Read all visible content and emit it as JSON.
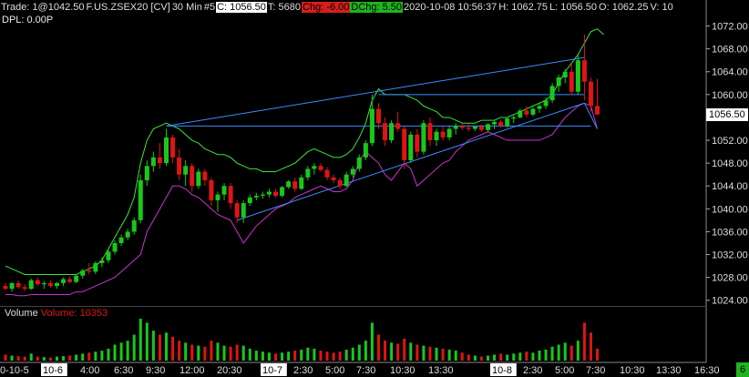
{
  "header": {
    "trade": "Trade: 1@1042.50",
    "symbol": "F.US.ZSEX20 [CV]",
    "interval": "30 Min",
    "num": "#5",
    "close": "C: 1056.50",
    "ticks": "T: 5680",
    "chg": "Chg: -6.00",
    "dchg": "DChg: 5.50",
    "datetime": "2020-10-08 10:56:37",
    "high": "H: 1062.75",
    "low": "L: 1056.50",
    "open": "O: 1062.25",
    "volume_tail": "V: 10"
  },
  "dpl": "DPL: 0.00P",
  "volume_label": "Volume",
  "volume_value": "Volume: 10353",
  "current_price": "1056.50",
  "badge": "6",
  "colors": {
    "bull": "#19c819",
    "bear": "#e01414",
    "upper_band": "#39e639",
    "lower_band": "#cc33cc",
    "trendline": "#3a8cff"
  },
  "chart_data": {
    "type": "candlestick",
    "price_axis": {
      "ticks": [
        "1072.00",
        "1068.00",
        "1064.00",
        "1060.00",
        "1056.00",
        "1052.00",
        "1048.00",
        "1044.00",
        "1040.00",
        "1036.00",
        "1032.00",
        "1028.00",
        "1024.00"
      ],
      "range": [
        1023,
        1074
      ]
    },
    "time_axis": {
      "labels": [
        "0-10-5",
        "10-6",
        "4:00",
        "6:30",
        "9:30",
        "12:00",
        "20:30",
        "10-7",
        "2:30",
        "5:00",
        "7:30",
        "10:30",
        "13:30",
        "10-8",
        "2:30",
        "5:00",
        "7:30",
        "10:30",
        "13:30",
        "16:30"
      ],
      "highlighted": [
        "10-6",
        "10-7",
        "10-8"
      ]
    },
    "candles": [
      [
        1026.5,
        1027.0,
        1025.8,
        1026.0
      ],
      [
        1026.0,
        1027.2,
        1025.5,
        1027.0
      ],
      [
        1027.0,
        1027.5,
        1026.0,
        1026.3
      ],
      [
        1026.3,
        1026.8,
        1025.6,
        1026.0
      ],
      [
        1026.0,
        1027.8,
        1025.8,
        1027.5
      ],
      [
        1027.5,
        1028.0,
        1026.5,
        1026.8
      ],
      [
        1026.8,
        1027.3,
        1026.0,
        1027.0
      ],
      [
        1027.0,
        1027.5,
        1026.2,
        1026.5
      ],
      [
        1026.5,
        1027.2,
        1026.0,
        1027.0
      ],
      [
        1027.0,
        1028.0,
        1026.5,
        1027.7
      ],
      [
        1027.7,
        1028.2,
        1027.0,
        1027.2
      ],
      [
        1027.2,
        1028.5,
        1027.0,
        1028.3
      ],
      [
        1028.3,
        1029.5,
        1027.8,
        1029.2
      ],
      [
        1029.2,
        1030.5,
        1028.5,
        1029.0
      ],
      [
        1029.0,
        1030.8,
        1028.6,
        1030.5
      ],
      [
        1030.5,
        1031.5,
        1029.8,
        1031.0
      ],
      [
        1031.0,
        1033.0,
        1030.5,
        1032.5
      ],
      [
        1032.5,
        1034.5,
        1032.0,
        1034.0
      ],
      [
        1034.0,
        1035.5,
        1033.5,
        1035.0
      ],
      [
        1035.0,
        1036.5,
        1034.5,
        1036.0
      ],
      [
        1036.0,
        1038.5,
        1035.5,
        1038.0
      ],
      [
        1038.0,
        1046.0,
        1037.5,
        1045.0
      ],
      [
        1045.0,
        1048.5,
        1044.0,
        1047.5
      ],
      [
        1047.5,
        1050.0,
        1046.5,
        1049.0
      ],
      [
        1049.0,
        1051.5,
        1047.0,
        1048.0
      ],
      [
        1048.0,
        1054.0,
        1047.5,
        1052.5
      ],
      [
        1052.5,
        1053.0,
        1048.0,
        1049.0
      ],
      [
        1049.0,
        1050.5,
        1045.0,
        1046.0
      ],
      [
        1046.0,
        1048.5,
        1044.0,
        1047.5
      ],
      [
        1047.5,
        1048.0,
        1043.0,
        1044.0
      ],
      [
        1044.0,
        1047.0,
        1043.5,
        1046.5
      ],
      [
        1046.5,
        1047.0,
        1044.0,
        1045.0
      ],
      [
        1045.0,
        1045.5,
        1040.5,
        1041.5
      ],
      [
        1041.5,
        1043.0,
        1039.5,
        1042.5
      ],
      [
        1042.5,
        1044.5,
        1041.5,
        1044.0
      ],
      [
        1044.0,
        1044.5,
        1040.0,
        1041.0
      ],
      [
        1041.0,
        1041.5,
        1037.5,
        1038.5
      ],
      [
        1038.5,
        1041.5,
        1037.5,
        1041.0
      ],
      [
        1041.0,
        1042.5,
        1040.5,
        1042.0
      ],
      [
        1042.0,
        1042.8,
        1041.5,
        1042.3
      ],
      [
        1042.3,
        1043.0,
        1041.8,
        1042.5
      ],
      [
        1042.5,
        1043.5,
        1042.0,
        1043.0
      ],
      [
        1043.0,
        1043.5,
        1042.0,
        1042.3
      ],
      [
        1042.3,
        1044.0,
        1042.0,
        1043.8
      ],
      [
        1043.8,
        1045.0,
        1043.5,
        1044.8
      ],
      [
        1044.8,
        1045.5,
        1043.0,
        1043.5
      ],
      [
        1043.5,
        1046.0,
        1043.3,
        1045.5
      ],
      [
        1045.5,
        1047.5,
        1045.0,
        1047.0
      ],
      [
        1047.0,
        1048.0,
        1046.0,
        1047.5
      ],
      [
        1047.5,
        1048.0,
        1046.5,
        1046.8
      ],
      [
        1046.8,
        1047.3,
        1045.0,
        1045.5
      ],
      [
        1045.5,
        1046.0,
        1044.5,
        1045.0
      ],
      [
        1045.0,
        1045.5,
        1043.5,
        1044.0
      ],
      [
        1044.0,
        1046.5,
        1043.8,
        1046.0
      ],
      [
        1046.0,
        1047.5,
        1045.5,
        1047.0
      ],
      [
        1047.0,
        1049.5,
        1046.5,
        1049.0
      ],
      [
        1049.0,
        1052.0,
        1048.5,
        1051.5
      ],
      [
        1051.5,
        1060.0,
        1051.0,
        1057.5
      ],
      [
        1057.5,
        1058.5,
        1054.0,
        1055.0
      ],
      [
        1055.0,
        1056.0,
        1051.0,
        1052.0
      ],
      [
        1052.0,
        1055.5,
        1051.5,
        1055.0
      ],
      [
        1055.0,
        1057.0,
        1053.5,
        1054.0
      ],
      [
        1054.0,
        1054.5,
        1047.0,
        1048.5
      ],
      [
        1048.5,
        1053.5,
        1048.0,
        1053.0
      ],
      [
        1053.0,
        1054.0,
        1049.0,
        1050.0
      ],
      [
        1050.0,
        1055.5,
        1049.5,
        1055.0
      ],
      [
        1055.0,
        1056.0,
        1051.0,
        1052.0
      ],
      [
        1052.0,
        1054.0,
        1051.0,
        1053.5
      ],
      [
        1053.5,
        1054.5,
        1052.0,
        1052.5
      ],
      [
        1052.5,
        1054.5,
        1052.0,
        1054.0
      ],
      [
        1054.0,
        1055.0,
        1053.0,
        1054.5
      ],
      [
        1054.5,
        1055.0,
        1053.8,
        1054.2
      ],
      [
        1054.2,
        1054.8,
        1053.5,
        1054.0
      ],
      [
        1054.0,
        1054.6,
        1053.6,
        1054.4
      ],
      [
        1054.4,
        1054.8,
        1053.5,
        1053.8
      ],
      [
        1053.8,
        1055.0,
        1053.5,
        1054.8
      ],
      [
        1054.8,
        1055.5,
        1054.0,
        1055.2
      ],
      [
        1055.2,
        1055.6,
        1054.2,
        1054.5
      ],
      [
        1054.5,
        1056.0,
        1054.2,
        1055.8
      ],
      [
        1055.8,
        1056.5,
        1055.0,
        1056.0
      ],
      [
        1056.0,
        1057.5,
        1055.8,
        1057.2
      ],
      [
        1057.2,
        1058.0,
        1056.0,
        1056.5
      ],
      [
        1056.5,
        1057.8,
        1056.2,
        1057.5
      ],
      [
        1057.5,
        1058.5,
        1056.8,
        1058.0
      ],
      [
        1058.0,
        1059.5,
        1057.5,
        1059.0
      ],
      [
        1059.0,
        1062.0,
        1058.5,
        1061.5
      ],
      [
        1061.5,
        1063.5,
        1060.5,
        1063.0
      ],
      [
        1063.0,
        1064.5,
        1062.0,
        1064.0
      ],
      [
        1064.0,
        1065.5,
        1060.0,
        1060.5
      ],
      [
        1060.5,
        1067.0,
        1060.0,
        1066.0
      ],
      [
        1066.0,
        1070.5,
        1059.0,
        1062.25
      ],
      [
        1062.25,
        1063.0,
        1057.0,
        1058.0
      ],
      [
        1058.0,
        1062.75,
        1056.5,
        1056.5
      ]
    ],
    "volume": [
      60,
      50,
      45,
      40,
      70,
      40,
      35,
      30,
      40,
      45,
      50,
      60,
      70,
      80,
      90,
      100,
      120,
      160,
      180,
      200,
      260,
      420,
      380,
      300,
      260,
      280,
      240,
      200,
      180,
      160,
      150,
      140,
      200,
      180,
      150,
      140,
      160,
      150,
      120,
      100,
      90,
      80,
      70,
      80,
      90,
      100,
      110,
      130,
      120,
      100,
      90,
      80,
      90,
      110,
      130,
      160,
      200,
      380,
      260,
      200,
      180,
      170,
      220,
      180,
      160,
      150,
      140,
      130,
      120,
      110,
      100,
      80,
      60,
      50,
      40,
      50,
      60,
      70,
      60,
      70,
      80,
      90,
      80,
      100,
      110,
      140,
      160,
      180,
      150,
      200,
      380,
      280,
      120
    ],
    "upper_band": [
      1030,
      1029.5,
      1029,
      1028.5,
      1028.5,
      1028.5,
      1028.5,
      1028.5,
      1028.5,
      1028.5,
      1028.5,
      1028.5,
      1029,
      1029.5,
      1030,
      1031,
      1033,
      1035,
      1037,
      1039,
      1042,
      1048,
      1052,
      1054,
      1054.5,
      1055,
      1054.5,
      1054,
      1053,
      1052,
      1051.5,
      1050.5,
      1050,
      1049.5,
      1049.5,
      1049,
      1048,
      1047.5,
      1047,
      1047,
      1046.5,
      1046.5,
      1046.5,
      1047,
      1047.5,
      1048,
      1049,
      1050,
      1050.5,
      1050,
      1049.5,
      1049,
      1049,
      1049.5,
      1050.5,
      1052.5,
      1055,
      1059,
      1061,
      1060,
      1060,
      1060,
      1060,
      1059.5,
      1059,
      1058,
      1057.5,
      1057,
      1056,
      1056,
      1055.5,
      1055,
      1055,
      1055,
      1055.5,
      1055.5,
      1055.5,
      1056,
      1056,
      1056.5,
      1057,
      1057.5,
      1058,
      1058.5,
      1059,
      1060,
      1062,
      1064,
      1065.5,
      1067,
      1069,
      1071,
      1071.5,
      1070.5
    ],
    "lower_band": [
      1025,
      1025,
      1024.8,
      1024.8,
      1025,
      1025,
      1025,
      1025,
      1025,
      1025,
      1025,
      1025.5,
      1025.5,
      1026,
      1026.5,
      1027,
      1027.5,
      1028,
      1029,
      1030,
      1031,
      1032,
      1036,
      1038,
      1040,
      1042,
      1044,
      1044,
      1043.5,
      1042.5,
      1042,
      1041,
      1040,
      1039,
      1038.5,
      1038,
      1036,
      1034,
      1035.5,
      1037,
      1038,
      1039,
      1040,
      1040.5,
      1041,
      1042,
      1042.5,
      1043,
      1043.5,
      1044,
      1043.5,
      1043,
      1043,
      1043.5,
      1045,
      1048.5,
      1050,
      1049,
      1048,
      1046,
      1045,
      1046.5,
      1048,
      1047,
      1044,
      1045,
      1046,
      1047,
      1048,
      1048.5,
      1050,
      1051,
      1052,
      1052.5,
      1053,
      1053.5,
      1053,
      1052.5,
      1052,
      1052,
      1052,
      1052,
      1052,
      1052,
      1052.5,
      1053,
      1054.5,
      1056,
      1057,
      1058,
      1058.5,
      1058,
      1054
    ]
  }
}
